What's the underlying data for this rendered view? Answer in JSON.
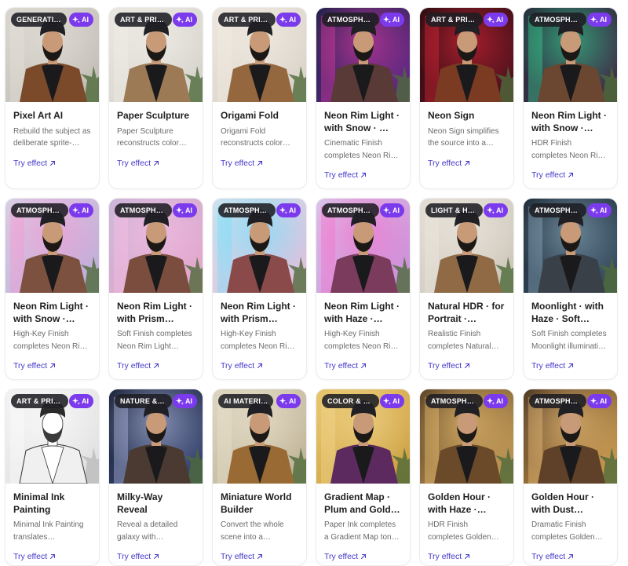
{
  "ui": {
    "ai_label": "AI",
    "try_label": "Try effect",
    "accent": "#7c3aed",
    "link_color": "#4338ca"
  },
  "cards": [
    {
      "category": "GENERATI…",
      "title": "Pixel Art AI",
      "description": "Rebuild the subject as deliberate sprite-…",
      "thumb": {
        "bg1": "#d9d6d0",
        "bg2": "#bdb8b0",
        "jacket": "#7a4a2a",
        "accent": "#e8e4dc"
      }
    },
    {
      "category": "ART & PRINT",
      "title": "Paper Sculpture",
      "description": "Paper Sculpture reconstructs color…",
      "thumb": {
        "bg1": "#e9e6e0",
        "bg2": "#d2cfc8",
        "jacket": "#9b7a55",
        "accent": "#f4f1ea"
      }
    },
    {
      "category": "ART & PRINT",
      "title": "Origami Fold",
      "description": "Origami Fold reconstructs color…",
      "thumb": {
        "bg1": "#ebe5dd",
        "bg2": "#d6cfc4",
        "jacket": "#94673f",
        "accent": "#f5efe6"
      }
    },
    {
      "category": "ATMOSPHE…",
      "title": "Neon Rim Light · with Snow · …",
      "description": "Cinematic Finish completes Neon Ri…",
      "thumb": {
        "bg1": "#1b2148",
        "bg2": "#6b2a8c",
        "jacket": "#5a3a36",
        "accent": "#ff3fb0"
      }
    },
    {
      "category": "ART & PRINT",
      "title": "Neon Sign",
      "description": "Neon Sign simplifies the source into a…",
      "thumb": {
        "bg1": "#2a0d10",
        "bg2": "#5a1320",
        "jacket": "#7a3b22",
        "accent": "#ff2a40"
      }
    },
    {
      "category": "ATMOSPHE…",
      "title": "Neon Rim Light · with Snow · HD…",
      "description": "HDR Finish completes Neon Ri…",
      "thumb": {
        "bg1": "#262b3a",
        "bg2": "#44334e",
        "jacket": "#6b4630",
        "accent": "#38f0a0"
      }
    },
    {
      "category": "ATMOSPHE…",
      "title": "Neon Rim Light · with Snow · Hig…",
      "description": "High-Key Finish completes Neon Ri…",
      "thumb": {
        "bg1": "#d6d3e6",
        "bg2": "#b9a9d6",
        "jacket": "#7d5140",
        "accent": "#ff8fd0"
      }
    },
    {
      "category": "ATMOSPHE…",
      "title": "Neon Rim Light · with Prism Light…",
      "description": "Soft Finish completes Neon Rim Light…",
      "thumb": {
        "bg1": "#c8b7d9",
        "bg2": "#e6a3c8",
        "jacket": "#7a4d3f",
        "accent": "#ffc0e6"
      }
    },
    {
      "category": "ATMOSPHE…",
      "title": "Neon Rim Light · with Prism Light…",
      "description": "High-Key Finish completes Neon Ri…",
      "thumb": {
        "bg1": "#cfe3ee",
        "bg2": "#e7b8d8",
        "jacket": "#8a4a4a",
        "accent": "#60e0ff"
      }
    },
    {
      "category": "ATMOSPHE…",
      "title": "Neon Rim Light · with Haze · High…",
      "description": "High-Key Finish completes Neon Ri…",
      "thumb": {
        "bg1": "#d9c8ea",
        "bg2": "#c78ad6",
        "jacket": "#7b3b5c",
        "accent": "#ff60c8"
      }
    },
    {
      "category": "LIGHT & HDR",
      "title": "Natural HDR · for Portrait · Realisti…",
      "description": "Realistic Finish completes Natural…",
      "thumb": {
        "bg1": "#e2ddd4",
        "bg2": "#c9c2b6",
        "jacket": "#8f6a45",
        "accent": "#f0ebe2"
      }
    },
    {
      "category": "ATMOSPHE…",
      "title": "Moonlight · with Haze · Soft Finish",
      "description": "Soft Finish completes Moonlight illuminati…",
      "thumb": {
        "bg1": "#1d2a36",
        "bg2": "#3b5466",
        "jacket": "#3a4048",
        "accent": "#9fc1d8"
      }
    },
    {
      "category": "ART & PRINT",
      "title": "Minimal Ink Painting",
      "description": "Minimal Ink Painting translates…",
      "thumb": {
        "bg1": "#f3f3f3",
        "bg2": "#dcdcdc",
        "jacket": "#f0f0f0",
        "accent": "#ffffff",
        "ink": true
      }
    },
    {
      "category": "NATURE & …",
      "title": "Milky-Way Reveal",
      "description": "Reveal a detailed galaxy with…",
      "thumb": {
        "bg1": "#1a2238",
        "bg2": "#3d4b7a",
        "jacket": "#4a3a32",
        "accent": "#cfd8ff"
      }
    },
    {
      "category": "AI MATERI…",
      "title": "Miniature World Builder",
      "description": "Convert the whole scene into a…",
      "thumb": {
        "bg1": "#dcd4c0",
        "bg2": "#b9ad90",
        "jacket": "#9a6a35",
        "accent": "#efe6d0"
      }
    },
    {
      "category": "COLOR & TONE",
      "title": "Gradient Map · Plum and Gold · …",
      "description": "Paper Ink completes a Gradient Map ton…",
      "thumb": {
        "bg1": "#e8c46a",
        "bg2": "#c79a3c",
        "jacket": "#5c2a5e",
        "accent": "#f4dc98"
      }
    },
    {
      "category": "ATMOSPHE…",
      "title": "Golden Hour · with Haze · HDR…",
      "description": "HDR Finish completes Golden…",
      "thumb": {
        "bg1": "#5a4126",
        "bg2": "#caa05a",
        "jacket": "#6b4a2a",
        "accent": "#ffd27a"
      }
    },
    {
      "category": "ATMOSPHE…",
      "title": "Golden Hour · with Dust Motes…",
      "description": "Dramatic Finish completes Golden…",
      "thumb": {
        "bg1": "#4a3420",
        "bg2": "#d8a552",
        "jacket": "#5f4028",
        "accent": "#ffd08a"
      }
    }
  ]
}
